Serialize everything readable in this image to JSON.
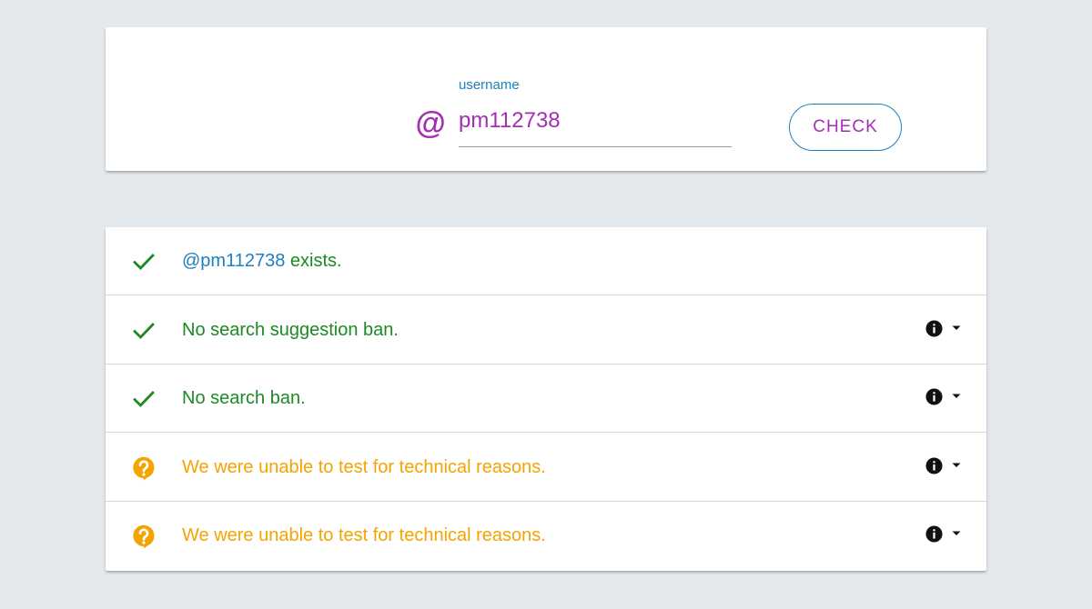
{
  "colors": {
    "background": "#e4e9ee",
    "purple": "#a330b2",
    "blue": "#1e7fbf",
    "green": "#1b8a24",
    "amber": "#f5a300",
    "dark": "#111111"
  },
  "search": {
    "icon": "at-sign-icon",
    "icon_glyph": "@",
    "label": "username",
    "value": "pm112738",
    "button_label": "CHECK"
  },
  "results": [
    {
      "status": "ok",
      "icon": "checkmark-icon",
      "handle": "@pm112738",
      "text": " exists.",
      "has_info": false
    },
    {
      "status": "ok",
      "icon": "checkmark-icon",
      "handle": "",
      "text": "No search suggestion ban.",
      "has_info": true,
      "info_icon": "info-icon",
      "dropdown_icon": "caret-down-icon"
    },
    {
      "status": "ok",
      "icon": "checkmark-icon",
      "handle": "",
      "text": "No search ban.",
      "has_info": true,
      "info_icon": "info-icon",
      "dropdown_icon": "caret-down-icon"
    },
    {
      "status": "unknown",
      "icon": "question-bubble-icon",
      "handle": "",
      "text": "We were unable to test for technical reasons.",
      "has_info": true,
      "info_icon": "info-icon",
      "dropdown_icon": "caret-down-icon"
    },
    {
      "status": "unknown",
      "icon": "question-bubble-icon",
      "handle": "",
      "text": "We were unable to test for technical reasons.",
      "has_info": true,
      "info_icon": "info-icon",
      "dropdown_icon": "caret-down-icon"
    }
  ]
}
